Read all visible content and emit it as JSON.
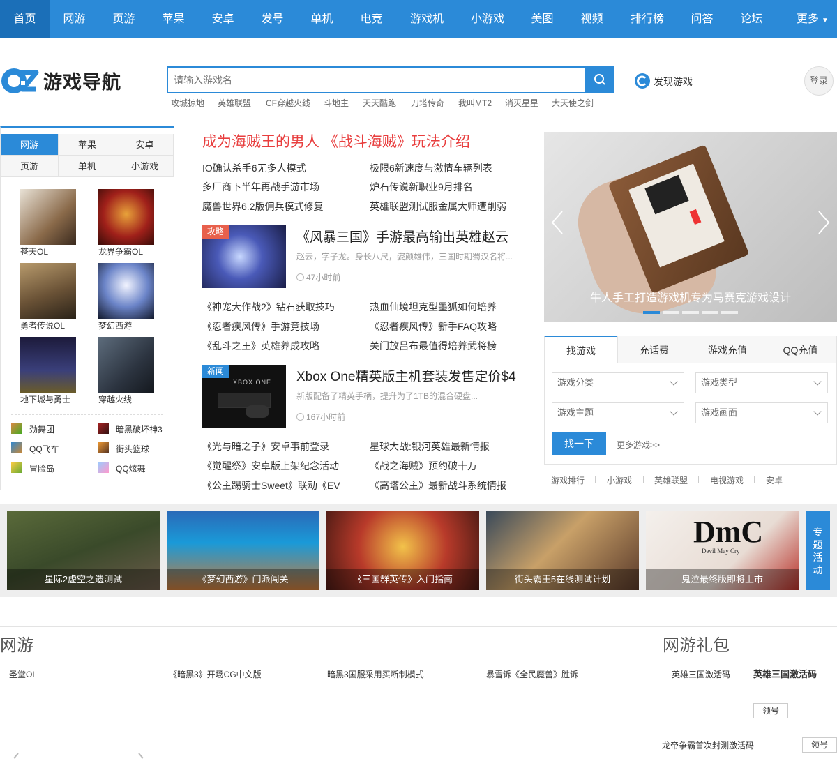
{
  "nav": {
    "items": [
      "首页",
      "网游",
      "页游",
      "苹果",
      "安卓",
      "发号",
      "单机",
      "电竞",
      "游戏机",
      "小游戏",
      "美图",
      "视频",
      "排行榜",
      "问答",
      "论坛"
    ],
    "more": "更多"
  },
  "header": {
    "logo_text": "游戏导航",
    "search_placeholder": "请输入游戏名",
    "hot_tags": [
      "攻城掠地",
      "英雄联盟",
      "CF穿越火线",
      "斗地主",
      "天天酷跑",
      "刀塔传奇",
      "我叫MT2",
      "消灭星星",
      "大天使之剑"
    ],
    "discover": "发现游戏",
    "login": "登录"
  },
  "left": {
    "tabs": [
      "网游",
      "苹果",
      "安卓",
      "页游",
      "单机",
      "小游戏"
    ],
    "games": [
      "苍天OL",
      "龙界争霸OL",
      "勇者传说OL",
      "梦幻西游",
      "地下城与勇士",
      "穿越火线"
    ],
    "mini_games": [
      "劲舞团",
      "暗黑破坏神3",
      "QQ飞车",
      "街头篮球",
      "冒险岛",
      "QQ炫舞"
    ]
  },
  "middle": {
    "headline": "成为海贼王的男人 《战斗海贼》玩法介绍",
    "links_a": [
      "IO确认杀手6无多人模式",
      "极限6新速度与激情车辆列表",
      "多厂商下半年再战手游市场",
      "炉石传说新职业9月排名",
      "魔兽世界6.2版佣兵模式修复",
      "英雄联盟测试服金属大师遭削弱"
    ],
    "feature1": {
      "tag": "攻略",
      "title": "《风暴三国》手游最高输出英雄赵云",
      "desc": "赵云，字子龙。身长八尺，姿颜雄伟，三国时期蜀汉名将...",
      "time": "47小时前"
    },
    "links_b": [
      "《神宠大作战2》钻石获取技巧",
      "热血仙境坦克型墨狐如何培养",
      "《忍者疾风传》手游竞技场",
      "《忍者疾风传》新手FAQ攻略",
      "《乱斗之王》英雄养成攻略",
      "关门放吕布最值得培养武将榜"
    ],
    "feature2": {
      "tag": "新闻",
      "title": "Xbox One精英版主机套装发售定价$4",
      "desc": "新版配备了精英手柄，提升为了1TB的混合硬盘...",
      "time": "167小时前",
      "img_text": "XBOX ONE"
    },
    "links_c": [
      "《光与暗之子》安卓事前登录",
      "星球大战:银河英雄最新情报",
      "《觉醒祭》安卓版上架纪念活动",
      "《战之海贼》预约破十万",
      "《公主踢骑士Sweet》联动《EV",
      "《高塔公主》最新战斗系统情报"
    ]
  },
  "right": {
    "slider_caption": "牛人手工打造游戏机专为马赛克游戏设计",
    "tabs": [
      "找游戏",
      "充话费",
      "游戏充值",
      "QQ充值"
    ],
    "selects": [
      "游戏分类",
      "游戏类型",
      "游戏主题",
      "游戏画面"
    ],
    "find_btn": "找一下",
    "more": "更多游戏>>",
    "links": [
      "游戏排行",
      "小游戏",
      "英雄联盟",
      "电视游戏",
      "安卓"
    ]
  },
  "banner": {
    "cards": [
      "星际2虚空之遗测试",
      "《梦幻西游》门派闯关",
      "《三国群英传》入门指南",
      "街头霸王5在线测试计划",
      "鬼泣最终版即将上市"
    ],
    "special": "专题活动",
    "dmc_logo": "DmC",
    "dmc_sub": "Devil May Cry"
  },
  "bottom": {
    "section_online": "网游",
    "section_gift": "网游礼包",
    "links": [
      "圣堂OL",
      "《暗黑3》开场CG中文版",
      "暗黑3国服采用买断制模式",
      "暴雪诉《全民魔兽》胜诉"
    ],
    "gift_items": [
      "英雄三国激活码",
      "英雄三国激活码",
      "龙帝争霸首次封测激活码"
    ],
    "claim": "领号"
  }
}
